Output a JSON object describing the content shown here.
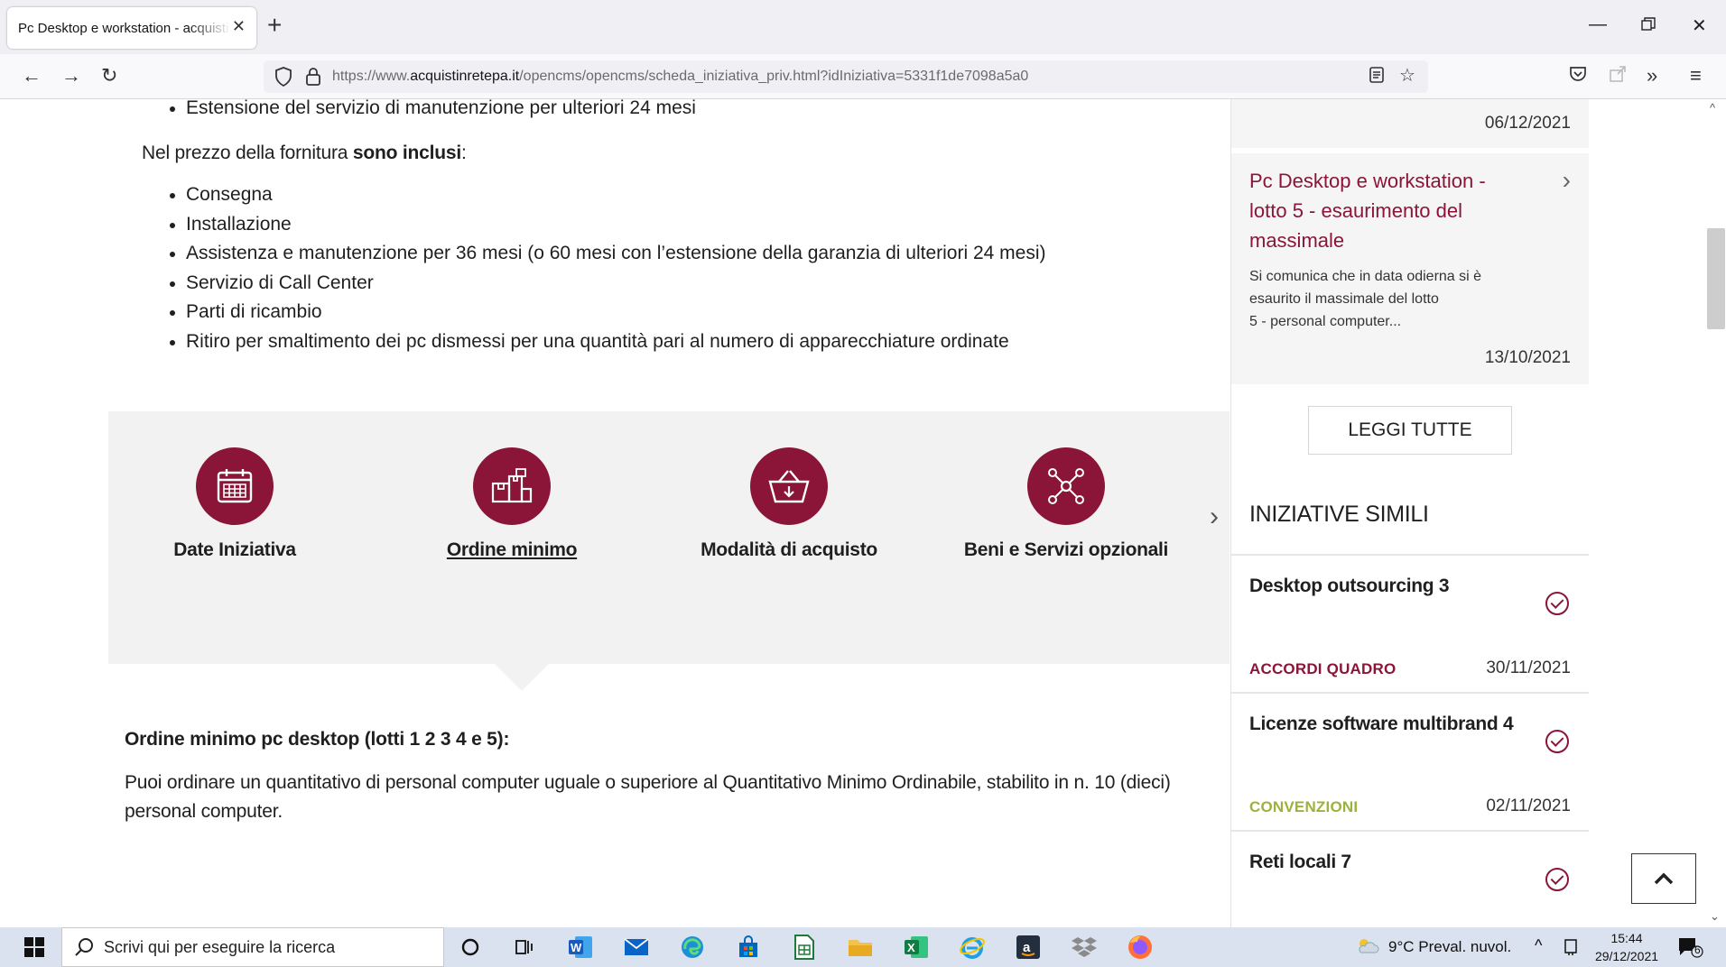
{
  "browser": {
    "tab_title": "Pc Desktop e workstation - acquistinretepa",
    "url_prefix": "https://www.",
    "url_domain": "acquistinretepa.it",
    "url_path": "/opencms/opencms/scheda_iniziativa_priv.html?idIniziativa=5331f1de7098a5a0"
  },
  "content": {
    "bullet_extension": "Estensione del servizio di manutenzione per ulteriori 24 mesi",
    "included_prefix": "Nel prezzo della fornitura ",
    "included_bold": "sono inclusi",
    "included_suffix": ":",
    "included_items": [
      "Consegna",
      "Installazione",
      "Assistenza e manutenzione per 36 mesi (o 60 mesi con l’estensione della garanzia di ulteriori 24 mesi)",
      "Servizio di Call Center",
      "Parti di ricambio",
      "Ritiro per smaltimento dei pc dismessi per una quantità pari al numero di apparecchiature ordinate"
    ],
    "features": [
      {
        "label": "Date Iniziativa",
        "icon": "calendar-icon"
      },
      {
        "label": "Ordine minimo",
        "icon": "boxes-icon"
      },
      {
        "label": "Modalità di acquisto",
        "icon": "basket-icon"
      },
      {
        "label": "Beni e Servizi opzionali",
        "icon": "network-icon"
      }
    ],
    "order_heading": "Ordine minimo pc desktop (lotti 1 2 3 4 e 5):",
    "order_text_line1": "Puoi ordinare un quantitativo di personal computer uguale o superiore al Quantitativo Minimo Ordinabile, stabilito in n. 10 (dieci)",
    "order_text_line2": "personal computer."
  },
  "sidebar": {
    "news_prev_date": "06/12/2021",
    "news": {
      "title_line1": "Pc Desktop e workstation -",
      "title_line2": "lotto 5 - esaurimento del",
      "title_line3": "massimale",
      "excerpt_line1": "Si comunica che in data odierna si è",
      "excerpt_line2": "esaurito il massimale del lotto",
      "excerpt_line3": "5 - personal computer...",
      "date": "13/10/2021"
    },
    "read_all_label": "LEGGI TUTTE",
    "similar_heading": "INIZIATIVE SIMILI",
    "similar": [
      {
        "title": "Desktop outsourcing 3",
        "category": "ACCORDI QUADRO",
        "date": "30/11/2021"
      },
      {
        "title": "Licenze software multibrand 4",
        "category": "CONVENZIONI",
        "date": "02/11/2021"
      },
      {
        "title": "Reti locali 7",
        "category": "",
        "date": ""
      }
    ],
    "colors": {
      "brand": "#8a1538",
      "accordi": "#8a1538",
      "convenzioni": "#9bb33a"
    }
  },
  "taskbar": {
    "search_placeholder": "Scrivi qui per eseguire la ricerca",
    "weather": "9°C  Preval. nuvol.",
    "time": "15:44",
    "date": "29/12/2021",
    "notifications": "6"
  }
}
